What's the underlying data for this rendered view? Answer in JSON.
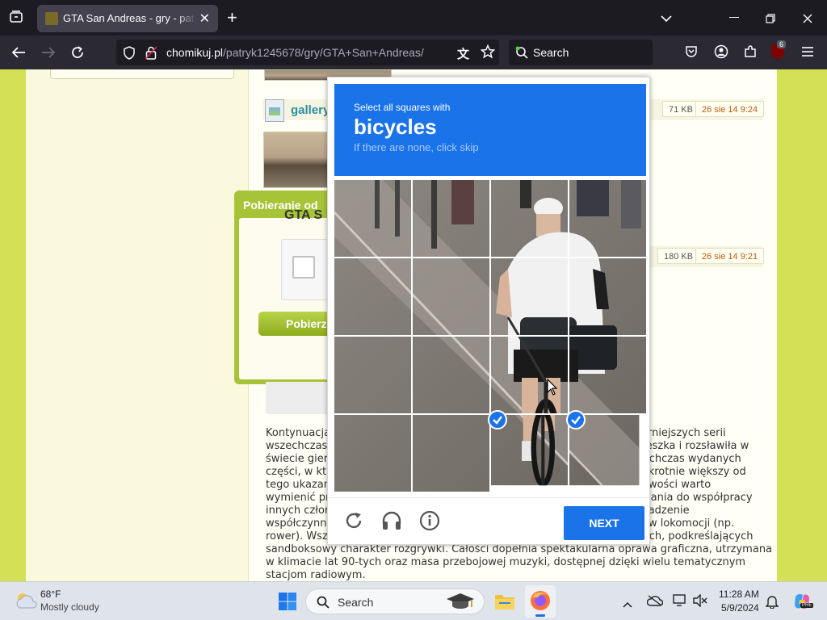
{
  "browser": {
    "tab_title": "GTA San Andreas - gry - patryk1245678",
    "tab_close": "✕",
    "new_tab": "+",
    "url_domain": "chomikuj.pl",
    "url_path": "/patryk1245678/gry/GTA+San+Andreas/",
    "search_placeholder": "Search",
    "extension_badge": "6"
  },
  "page": {
    "gallery_label": "gallery",
    "files": [
      {
        "size": "71 KB",
        "date": "26 sie 14 9:24"
      },
      {
        "size": "180 KB",
        "date": "26 sie 14 9:21"
      }
    ],
    "download_panel": {
      "header": "Pobieranie od",
      "title": "GTA S",
      "button": "Pobierz"
    },
    "description_left": [
      "Kontynuacja",
      "wszechczaso",
      "świecie gier",
      "części, w kt",
      "tego ukazan",
      "wymienić pr",
      "innych człon",
      "współczynni"
    ],
    "description_right": [
      "arniejszych serii",
      "ieszka i rozsławiła w",
      "ychczas wydanych",
      "ykrotnie większy od",
      "owości warto",
      "wania do współpracy",
      "vadzenie",
      "ów lokomocji (np."
    ],
    "description_full": [
      "rower). Wsz",
      "sandboksowy charakter rozgrywki. Całości dopełnia spektakularna oprawa graficzna, utrzymana",
      "w klimacie lat 90-tych oraz masa przebojowej muzyki, dostępnej dzięki wielu tematycznym",
      "stacjom radiowym."
    ],
    "description_line9_right": "ych, podkreślających"
  },
  "captcha": {
    "instruction": "Select all squares with",
    "target": "bicycles",
    "hint": "If there are none, click skip",
    "next_button": "NEXT",
    "selected_tiles": [
      14,
      15
    ],
    "icons": [
      "refresh-icon",
      "headphones-icon",
      "info-icon"
    ]
  },
  "taskbar": {
    "weather_temp": "68°F",
    "weather_desc": "Mostly cloudy",
    "search_label": "Search",
    "time": "11:28 AM",
    "date": "5/9/2024"
  },
  "colors": {
    "accent": "#1a73e8",
    "page_green": "#d4e157",
    "browser_dark": "#1c1b22"
  }
}
